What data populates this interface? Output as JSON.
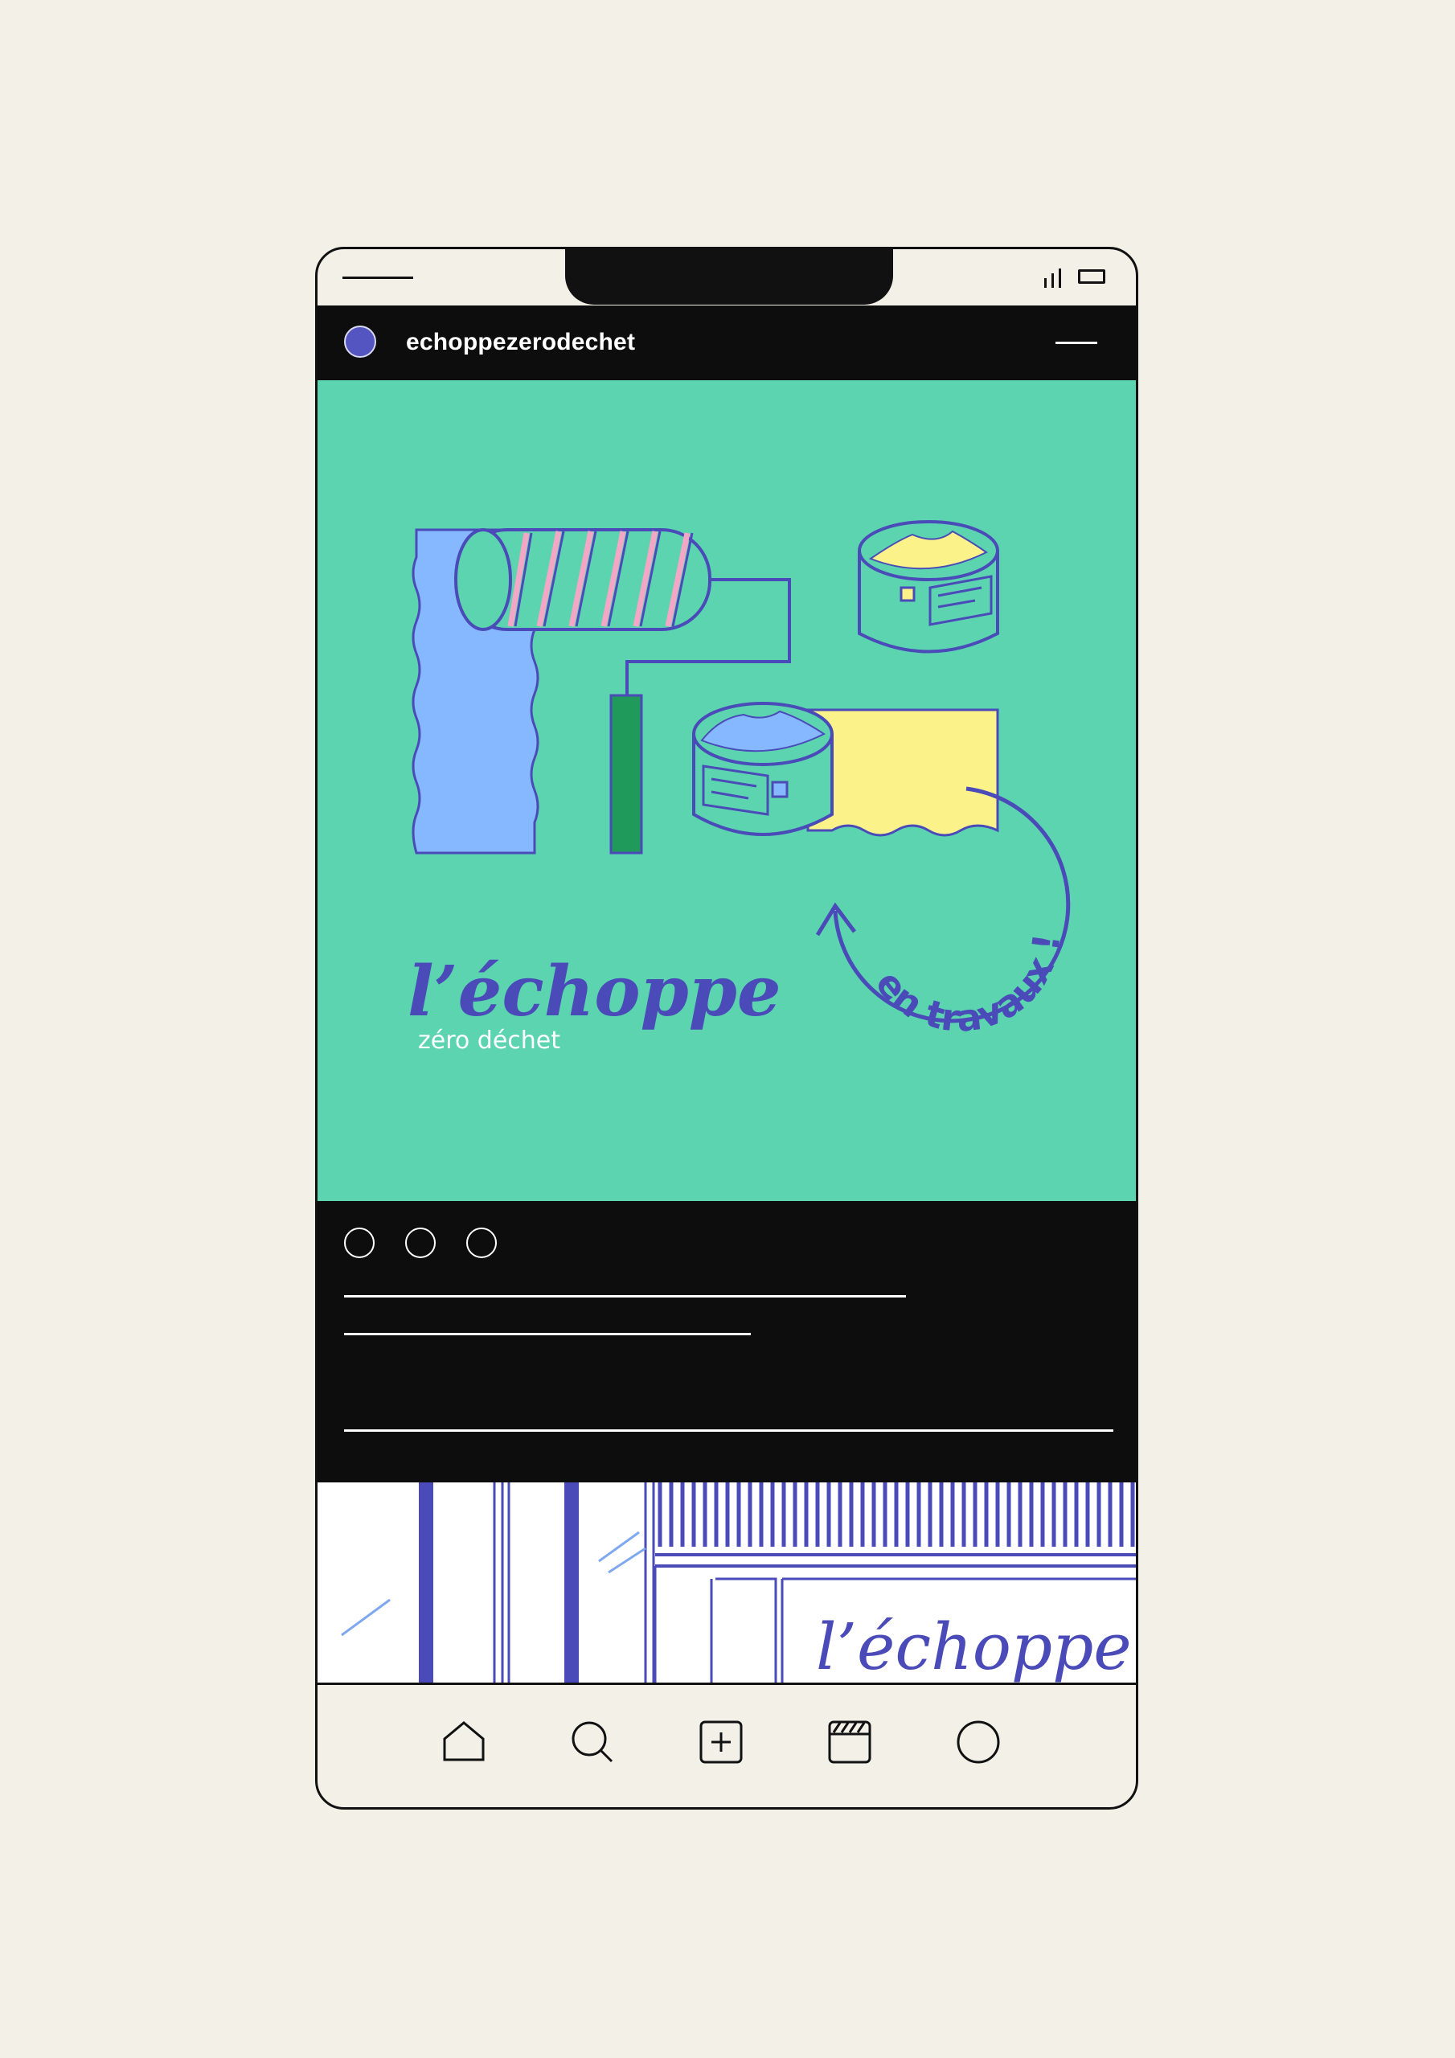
{
  "account": {
    "username": "echoppezerodechet",
    "avatar_color": "#5455c0"
  },
  "post": {
    "background_color": "#5cd4b0",
    "logo_title": "l’échoppe",
    "logo_subtitle": "zéro déchet",
    "badge_text": "en travaux !",
    "actions": [
      "like-icon",
      "comment-icon",
      "share-icon"
    ]
  },
  "next_post": {
    "sign_text": "l’échoppe"
  },
  "nav": {
    "items": [
      "home-icon",
      "search-icon",
      "create-icon",
      "reels-icon",
      "profile-icon"
    ]
  },
  "colors": {
    "ink": "#4a4bb8",
    "blue_paint": "#86b8ff",
    "yellow_paint": "#fbf38a",
    "green_handle": "#1f9a5a",
    "pink_stripe": "#f4a6c6"
  }
}
